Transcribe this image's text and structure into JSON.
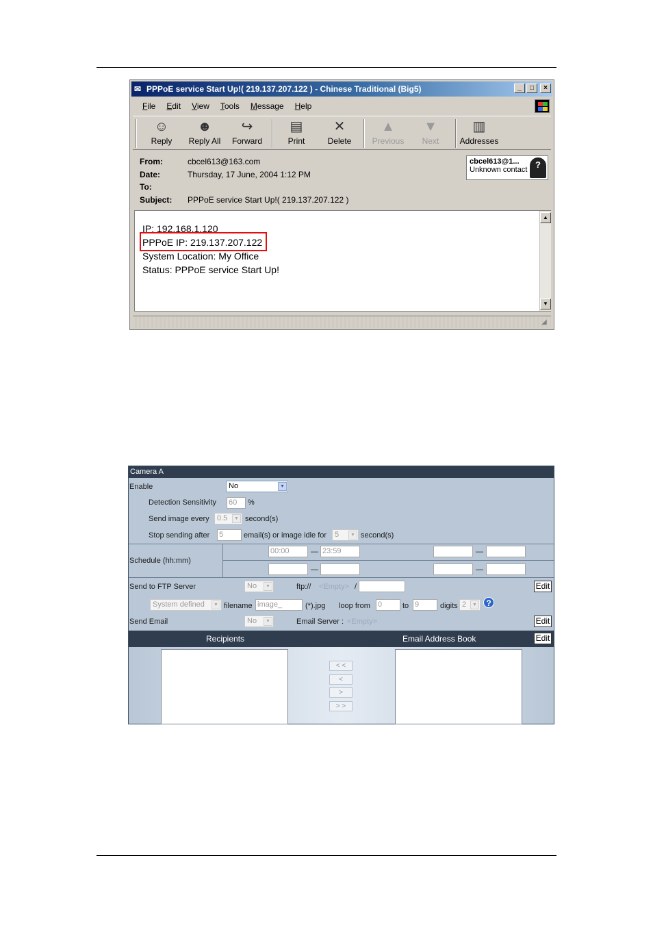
{
  "email_window": {
    "title": "PPPoE service Start Up!( 219.137.207.122 ) - Chinese Traditional (Big5)",
    "title_buttons": [
      "_",
      "□",
      "×"
    ],
    "menu": [
      "File",
      "Edit",
      "View",
      "Tools",
      "Message",
      "Help"
    ],
    "toolbar": [
      {
        "label": "Reply",
        "icon": "reply-icon",
        "glyph": "☺",
        "enabled": true
      },
      {
        "label": "Reply All",
        "icon": "reply-all-icon",
        "glyph": "☻",
        "enabled": true
      },
      {
        "label": "Forward",
        "icon": "forward-icon",
        "glyph": "↪",
        "enabled": true
      },
      {
        "label": "Print",
        "icon": "printer-icon",
        "glyph": "▤",
        "enabled": true
      },
      {
        "label": "Delete",
        "icon": "delete-icon",
        "glyph": "✕",
        "enabled": true
      },
      {
        "label": "Previous",
        "icon": "up-arrow-icon",
        "glyph": "▲",
        "enabled": false
      },
      {
        "label": "Next",
        "icon": "down-arrow-icon",
        "glyph": "▼",
        "enabled": false
      },
      {
        "label": "Addresses",
        "icon": "address-book-icon",
        "glyph": "▥",
        "enabled": true
      }
    ],
    "headers": {
      "from_label": "From:",
      "from": "cbcel613@163.com",
      "date_label": "Date:",
      "date": "Thursday, 17 June, 2004 1:12 PM",
      "to_label": "To:",
      "to": "",
      "subject_label": "Subject:",
      "subject": "PPPoE service Start Up!( 219.137.207.122 )"
    },
    "contact_card": {
      "name": "cbcel613@1...",
      "status": "Unknown contact",
      "avatar_glyph": "?"
    },
    "body_lines": [
      "IP: 192.168.1.120",
      "PPPoE IP: 219.137.207.122",
      "System Location: My Office",
      "Status: PPPoE service Start Up!"
    ]
  },
  "camera_panel": {
    "title": "Camera A",
    "enable": {
      "label": "Enable",
      "value": "No"
    },
    "detection_sensitivity": {
      "label": "Detection Sensitivity",
      "value": "60",
      "unit": "%"
    },
    "send_image_every": {
      "label": "Send image every",
      "value": "0.5",
      "unit": "second(s)"
    },
    "stop_sending": {
      "label": "Stop sending after",
      "value": "5",
      "mid": "email(s) or image idle for",
      "idle_value": "5",
      "unit": "second(s)"
    },
    "schedule": {
      "label": "Schedule (hh:mm)",
      "row1": {
        "start": "00:00",
        "end": "23:59",
        "start2": "",
        "end2": ""
      },
      "row2": {
        "start": "",
        "end": "",
        "start2": "",
        "end2": ""
      },
      "dash": "—"
    },
    "ftp": {
      "label": "Send to FTP Server",
      "value": "No",
      "prefix": "ftp://",
      "server": "<Empty>",
      "slash": "/",
      "path": "",
      "edit": "Edit"
    },
    "filename": {
      "mode": "System defined",
      "label": "filename",
      "value": "image_",
      "ext": "(*).jpg",
      "loop_label": "loop from",
      "loop_from": "0",
      "to_label": "to",
      "loop_to": "9",
      "digits_label": "digits",
      "digits": "2"
    },
    "email": {
      "label": "Send Email",
      "value": "No",
      "server_label": "Email Server :",
      "server": "<Empty>",
      "edit": "Edit"
    },
    "recipients": {
      "label": "Recipients",
      "book_label": "Email Address Book",
      "edit": "Edit"
    },
    "move_buttons": [
      "< <",
      "<",
      ">",
      "> >"
    ]
  }
}
